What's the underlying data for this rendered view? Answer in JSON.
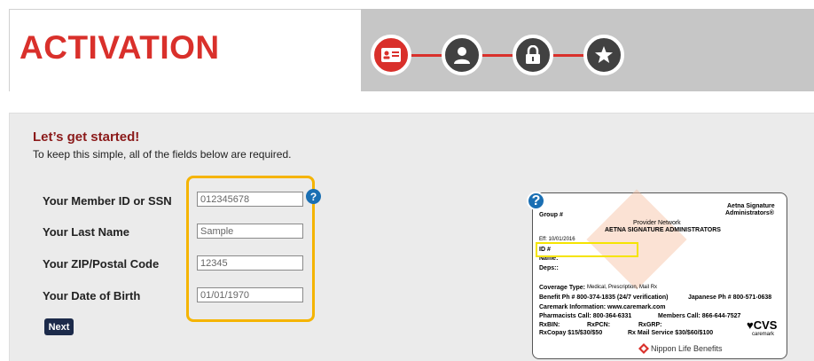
{
  "header": {
    "title": "ACTIVATION",
    "steps": [
      {
        "icon": "id-card-icon",
        "state": "active"
      },
      {
        "icon": "user-icon",
        "state": "inactive"
      },
      {
        "icon": "lock-icon",
        "state": "inactive"
      },
      {
        "icon": "star-icon",
        "state": "inactive"
      }
    ],
    "accent_color": "#d9302b"
  },
  "form": {
    "heading": "Let’s get started!",
    "subtext": "To keep this simple, all of the fields below are required.",
    "fields": [
      {
        "label": "Your Member ID or SSN",
        "value": "012345678"
      },
      {
        "label": "Your Last Name",
        "value": "Sample"
      },
      {
        "label": "Your ZIP/Postal Code",
        "value": "12345"
      },
      {
        "label": "Your Date of Birth",
        "value": "01/01/1970"
      }
    ],
    "help_icon": "?",
    "next_label": "Next"
  },
  "card": {
    "help_icon": "?",
    "group": "Group #",
    "admin_line1": "Aetna Signature",
    "admin_line2": "Administrators®",
    "network": "Provider Network",
    "network_name": "AETNA SIGNATURE ADMINISTRATORS",
    "eff": "Eff: 10/01/2016",
    "id": "ID #",
    "name": "Name:",
    "deps": "Deps::",
    "coverage_label": "Coverage Type:",
    "coverage_value": "Medical, Prescription, Mail Rx",
    "benefit": "Benefit Ph # 800-374-1835 (24/7 verification)",
    "japanese": "Japanese Ph # 800-571-0638",
    "caremark": "Caremark Information: www.caremark.com",
    "pharmacists": "Pharmacists Call: 800-364-6331",
    "members": "Members Call: 866-644-7527",
    "rxbin": "RxBIN:",
    "rxpcn": "RxPCN:",
    "rxgrp": "RxGRP:",
    "rxcopay": "RxCopay $15/$30/$50",
    "mail_service": "Rx Mail Service $30/$60/$100",
    "cvs": "♥CVS",
    "cvs_sub": "caremark",
    "nippon": "Nippon Life Benefits"
  }
}
